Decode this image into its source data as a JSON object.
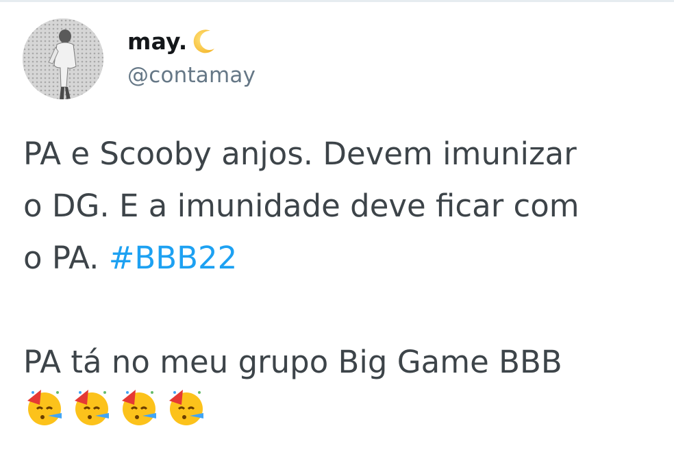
{
  "tweet": {
    "display_name": "may.",
    "display_name_icon": "crescent-moon-icon",
    "handle": "@contamay",
    "avatar": "avatar-photo",
    "text_lines": [
      "PA e Scooby anjos. Devem imunizar",
      "o DG. E a imunidade deve ficar com",
      "o PA. "
    ],
    "hashtag": "#BBB22",
    "second_paragraph": "PA tá no meu grupo Big Game BBB",
    "emojis": [
      "partying-face-icon",
      "partying-face-icon",
      "partying-face-icon",
      "partying-face-icon"
    ]
  },
  "colors": {
    "name": "#14171a",
    "handle": "#657786",
    "body_text": "#3d4449",
    "hashtag": "#1da1f2",
    "divider": "#e6ecf0"
  }
}
